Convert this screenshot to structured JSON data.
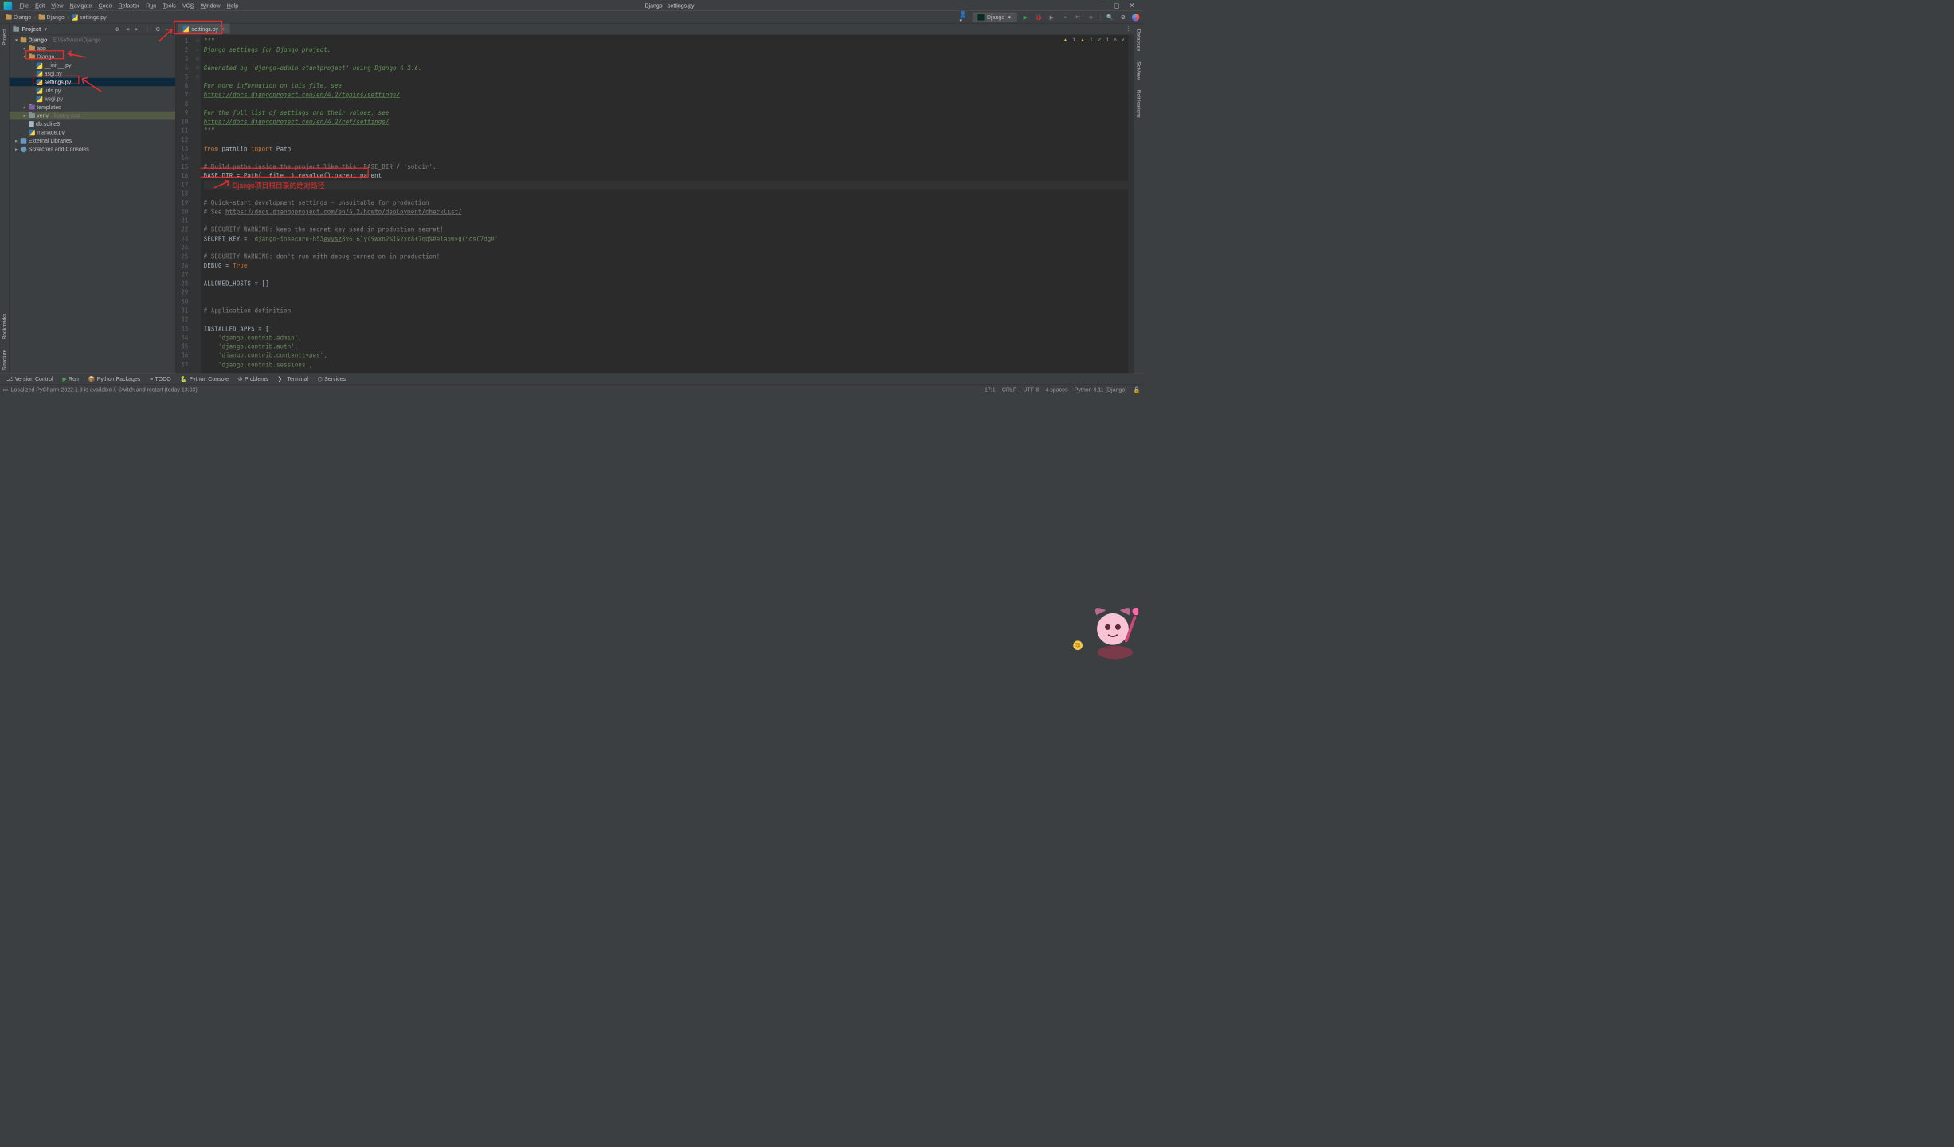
{
  "window": {
    "title": "Django - settings.py"
  },
  "menubar": [
    "File",
    "Edit",
    "View",
    "Navigate",
    "Code",
    "Refactor",
    "Run",
    "Tools",
    "VCS",
    "Window",
    "Help"
  ],
  "breadcrumbs": [
    "Django",
    "Django",
    "settings.py"
  ],
  "run_config": {
    "label": "Django"
  },
  "project_panel": {
    "title": "Project"
  },
  "tree": {
    "root": {
      "name": "Django",
      "path": "E:\\Software\\Django"
    },
    "app": {
      "name": "app"
    },
    "django_pkg": {
      "name": "Django"
    },
    "init": {
      "name": "__init__.py"
    },
    "asgi": {
      "name": "asgi.py"
    },
    "settings": {
      "name": "settings.py"
    },
    "urls": {
      "name": "urls.py"
    },
    "wsgi": {
      "name": "wsgi.py"
    },
    "templates": {
      "name": "templates"
    },
    "venv": {
      "name": "venv",
      "note": "library root"
    },
    "db": {
      "name": "db.sqlite3"
    },
    "manage": {
      "name": "manage.py"
    },
    "extlib": {
      "name": "External Libraries"
    },
    "scratch": {
      "name": "Scratches and Consoles"
    }
  },
  "editor_tab": {
    "label": "settings.py"
  },
  "code_lines": {
    "l1": "\"\"\"",
    "l2": "Django settings for Django project.",
    "l3": "",
    "l4": "Generated by 'django-admin startproject' using Django 4.2.6.",
    "l5": "",
    "l6": "For more information on this file, see",
    "l7": "https://docs.djangoproject.com/en/4.2/topics/settings/",
    "l8": "",
    "l9": "For the full list of settings and their values, see",
    "l10": "https://docs.djangoproject.com/en/4.2/ref/settings/",
    "l11": "\"\"\"",
    "l12": "",
    "l13a": "from ",
    "l13b": "pathlib ",
    "l13c": "import ",
    "l13d": "Path",
    "l14": "",
    "l15": "# Build paths inside the project like this: BASE_DIR / 'subdir'.",
    "l16": "BASE_DIR = Path(__file__).resolve().parent.parent",
    "l17": "",
    "l18": "",
    "l19": "# Quick-start development settings - unsuitable for production",
    "l20a": "# See ",
    "l20b": "https://docs.djangoproject.com/en/4.2/howto/deployment/checklist/",
    "l21": "",
    "l22": "# SECURITY WARNING: keep the secret key used in production secret!",
    "l23a": "SECRET_KEY = ",
    "l23b": "'django-insecure-h53",
    "l23c": "eyvsz",
    "l23d": "8y6_6)y(9wxn2%i&2xc8+7qq%#eiabw*g(^cs(7dg#'",
    "l24": "",
    "l25": "# SECURITY WARNING: don't run with debug turned on in production!",
    "l26a": "DEBUG = ",
    "l26b": "True",
    "l27": "",
    "l28": "ALLOWED_HOSTS = []",
    "l29": "",
    "l30": "",
    "l31": "# Application definition",
    "l32": "",
    "l33": "INSTALLED_APPS = [",
    "l34": "    'django.contrib.admin',",
    "l35": "    'django.contrib.auth',",
    "l36": "    'django.contrib.contenttypes',",
    "l37": "    'django.contrib.sessions',"
  },
  "inspections": {
    "warn1": "1",
    "warn2": "1",
    "ok": "1"
  },
  "annotation": {
    "text": "Django项目根目录的绝对路径"
  },
  "bottom_tools": [
    "Version Control",
    "Run",
    "Python Packages",
    "TODO",
    "Python Console",
    "Problems",
    "Terminal",
    "Services"
  ],
  "status": {
    "msg": "Localized PyCharm 2022.1.3 is available // Switch and restart (today 13:03)",
    "pos": "17:1",
    "eol": "CRLF",
    "enc": "UTF-8",
    "indent": "4 spaces",
    "interp": "Python 3.11 (Django)"
  },
  "sidetabs": {
    "left_project": "Project",
    "left_bookmarks": "Bookmarks",
    "left_structure": "Structure",
    "right_db": "Database",
    "right_sciview": "SciView",
    "right_notif": "Notifications"
  }
}
